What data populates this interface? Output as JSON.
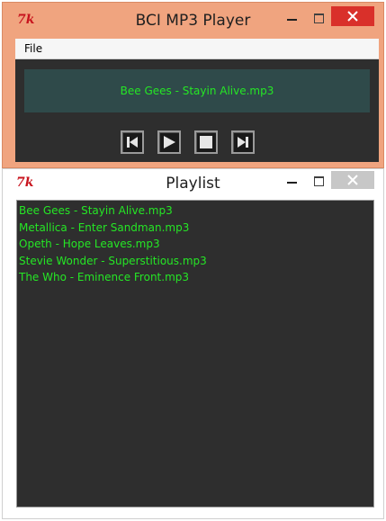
{
  "player": {
    "title": "BCI MP3 Player",
    "menu": [
      "File"
    ],
    "now_playing": "Bee Gees - Stayin Alive.mp3",
    "controls": [
      "previous",
      "play",
      "stop",
      "next"
    ]
  },
  "playlist": {
    "title": "Playlist",
    "items": [
      "Bee Gees - Stayin Alive.mp3",
      "Metallica - Enter Sandman.mp3",
      "Opeth - Hope Leaves.mp3",
      "Stevie Wonder - Superstitious.mp3",
      "The Who - Eminence Front.mp3"
    ]
  },
  "colors": {
    "active_titlebar": "#f0a47f",
    "close_active": "#d9302a",
    "close_inactive": "#c7c7c7",
    "panel_bg": "#2e2e2e",
    "nowplaying_bg": "#2f4a4a",
    "text_green": "#25e625"
  },
  "icons": {
    "app": "tk-feather-icon",
    "minimize": "minimize-icon",
    "maximize": "maximize-icon",
    "close": "close-icon"
  }
}
